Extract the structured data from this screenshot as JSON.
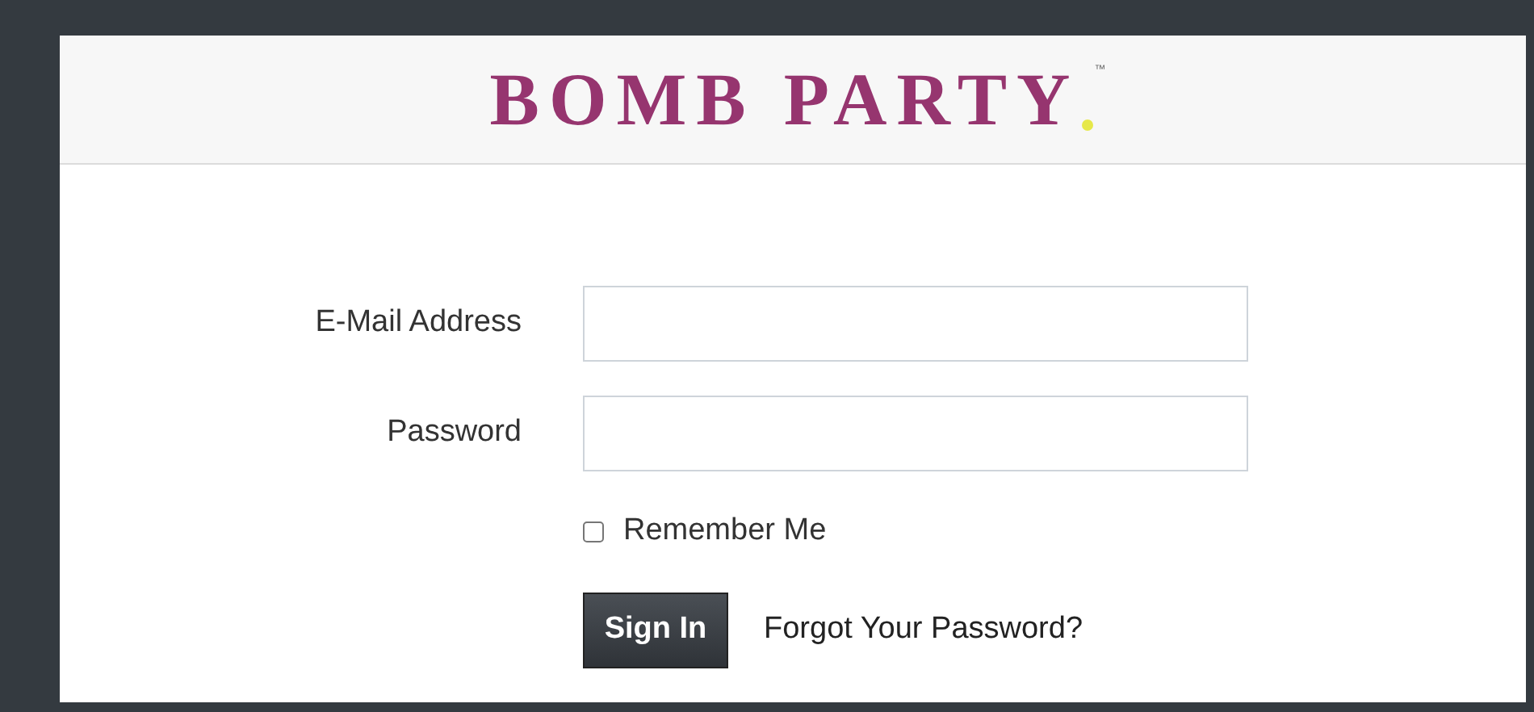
{
  "header": {
    "logo": "BOMB PARTY",
    "trademark": "™"
  },
  "form": {
    "fields": [
      {
        "label": "E-Mail Address"
      },
      {
        "label": "Password"
      }
    ],
    "remember": {
      "label": "Remember Me",
      "checked": false
    },
    "submit": "Sign In",
    "forgot_link": "Forgot Your Password?"
  }
}
